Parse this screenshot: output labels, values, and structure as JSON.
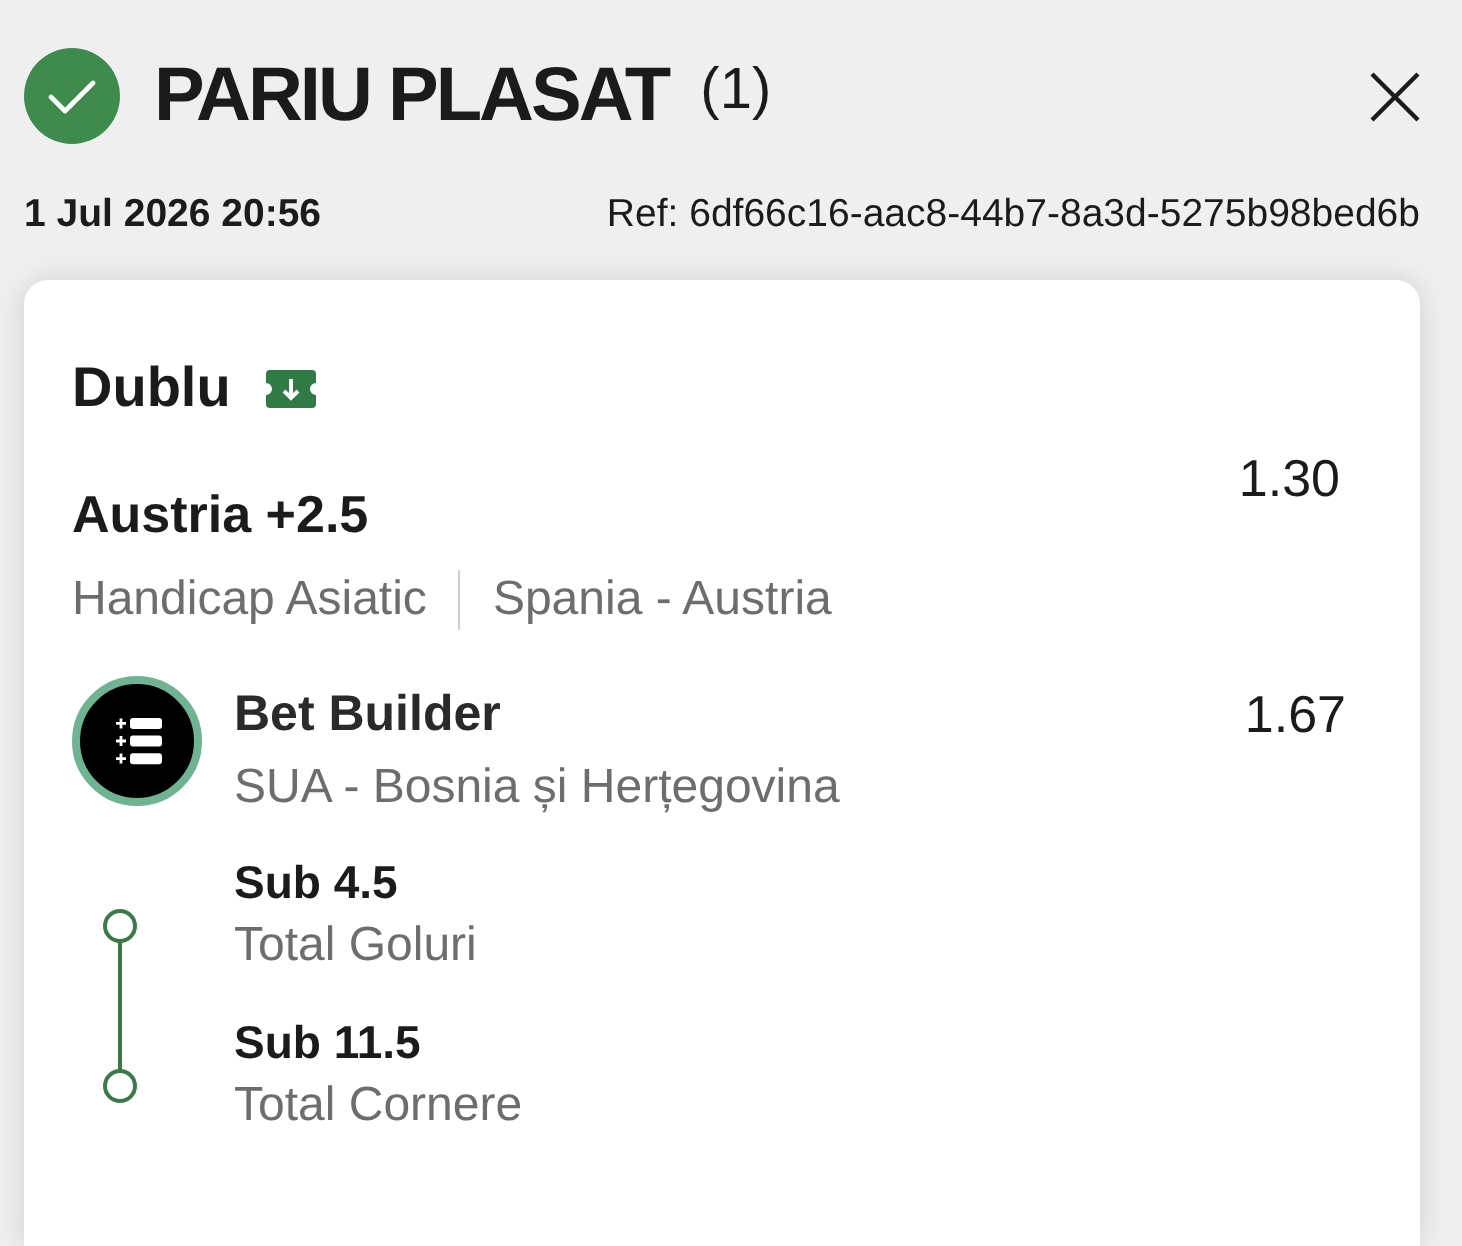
{
  "header": {
    "title": "PARIU PLASAT",
    "count": "(1)",
    "date": "1 Jul 2026 20:56",
    "ref": "Ref: 6df66c16-aac8-44b7-8a3d-5275b98bed6b"
  },
  "bet": {
    "type": "Dublu",
    "selections": [
      {
        "kind": "single",
        "pick": "Austria +2.5",
        "odds": "1.30",
        "market": "Handicap Asiatic",
        "event": "Spania - Austria"
      },
      {
        "kind": "builder",
        "title": "Bet Builder",
        "odds": "1.67",
        "event": "SUA - Bosnia și Herțegovina",
        "legs": [
          {
            "pick": "Sub 4.5",
            "market": "Total Goluri"
          },
          {
            "pick": "Sub 11.5",
            "market": "Total Cornere"
          }
        ]
      }
    ]
  }
}
